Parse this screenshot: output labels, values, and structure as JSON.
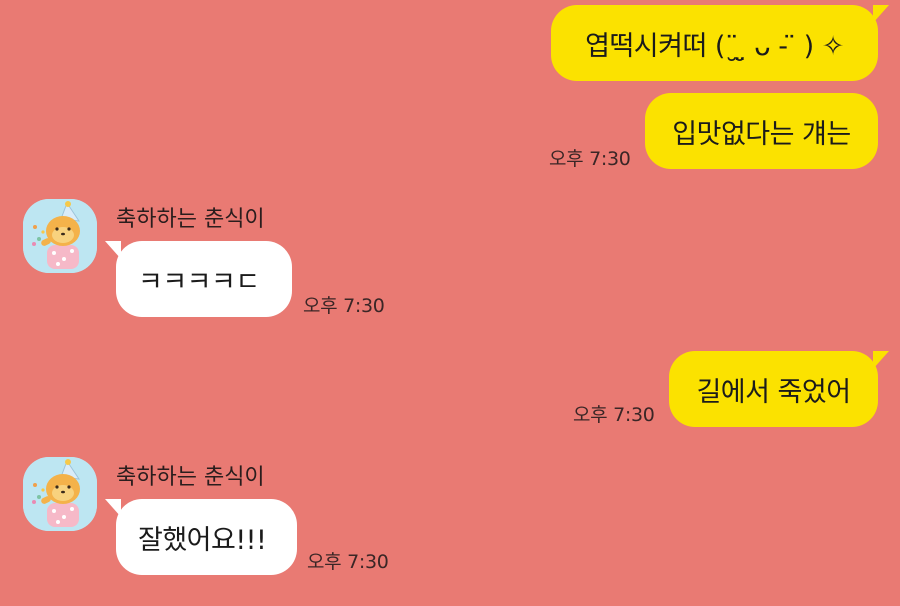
{
  "colors": {
    "background": "#e97a73",
    "outgoing_bubble": "#fbe200",
    "incoming_bubble": "#ffffff",
    "avatar_bg": "#bde6f2"
  },
  "messages": [
    {
      "direction": "outgoing",
      "text": "엽떡시켜떠 (¨̮ ̤̮ ᴗ - ̈ ) ✧"
    },
    {
      "direction": "outgoing",
      "text": "입맛없다는 걔는",
      "time": "오후 7:30"
    },
    {
      "direction": "incoming",
      "sender": "축하하는 춘식이",
      "avatar": "choonsik-party-hat-icon",
      "text": "ㅋㅋㅋㅋㄷ",
      "time": "오후 7:30"
    },
    {
      "direction": "outgoing",
      "text": "길에서 죽었어",
      "time": "오후 7:30"
    },
    {
      "direction": "incoming",
      "sender": "축하하는 춘식이",
      "avatar": "choonsik-party-hat-icon",
      "text": "잘했어요!!!",
      "time": "오후 7:30"
    }
  ]
}
